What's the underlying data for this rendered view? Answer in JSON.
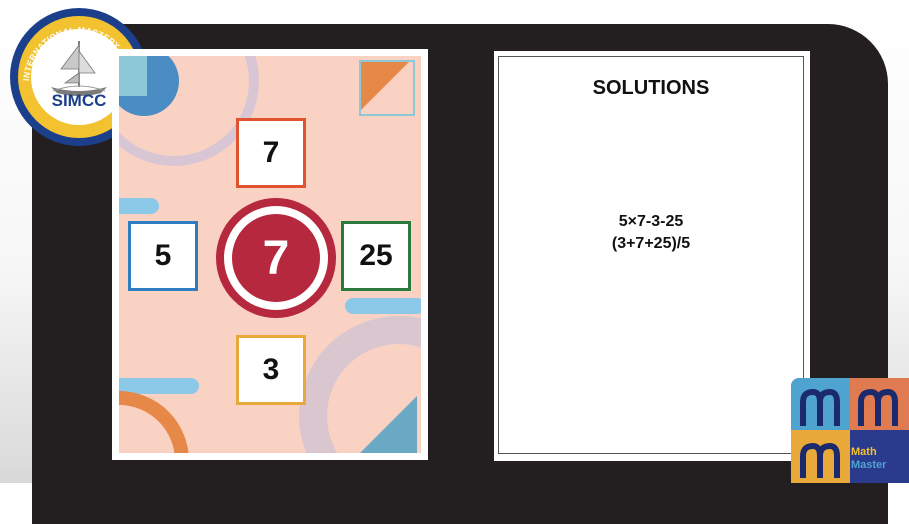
{
  "logo": {
    "circle_text": "SINGAPORE INTERNATIONAL MASTERY CONTESTS CENTER",
    "name": "SIMCC"
  },
  "puzzle": {
    "center": "7",
    "top": "7",
    "left": "5",
    "right": "25",
    "bottom": "3",
    "colors": {
      "center": "#b5283d",
      "top_border": "#e0532f",
      "left_border": "#2e7dc0",
      "right_border": "#2a7a3c",
      "bottom_border": "#e8a83a",
      "background": "#fad2c4"
    }
  },
  "solutions": {
    "title": "SOLUTIONS",
    "lines": [
      "5×7-3-25",
      "(3+7+25)/5"
    ]
  },
  "badge": {
    "line1": "Math",
    "line2": "Master"
  }
}
